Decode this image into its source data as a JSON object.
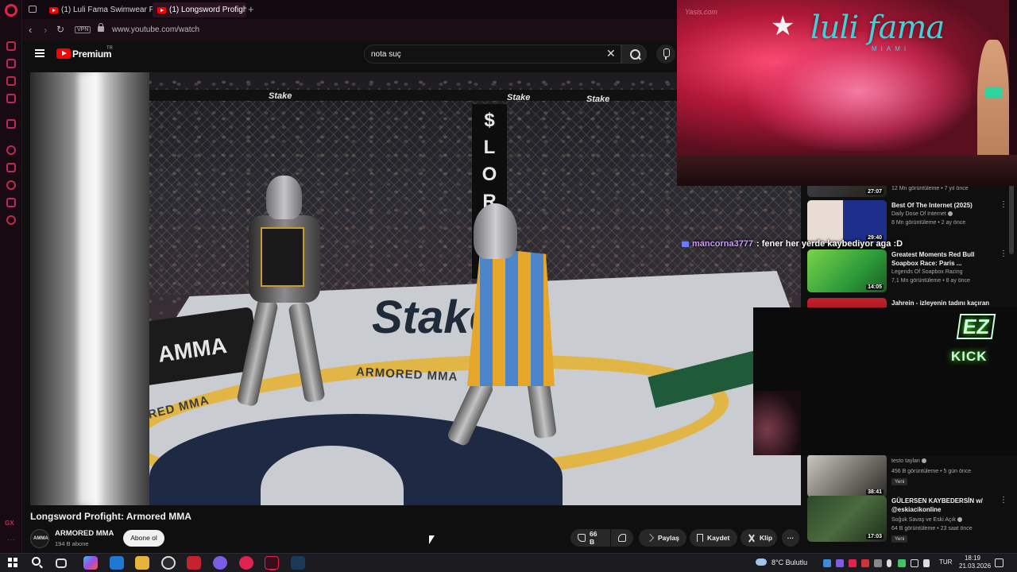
{
  "browser": {
    "tabs": [
      {
        "label": "(1) Luli Fama Swimwear Fa",
        "active": false
      },
      {
        "label": "(1) Longsword Profight",
        "active": true
      }
    ],
    "new_tab_symbol": "+",
    "url": "www.youtube.com/watch",
    "vpn_label": "VPN",
    "sidebar_badge": "GX",
    "sidebar_more": "···"
  },
  "youtube": {
    "brand": "Premium",
    "brand_sup": "TR",
    "search_value": "nota suç"
  },
  "video": {
    "title": "Longsword Profight: Armored MMA",
    "channel": "ARMORED MMA",
    "channel_avatar_text": "AMMA",
    "subscribers": "194 B abone",
    "subscribe_label": "Abone ol",
    "likes": "66 B",
    "share_label": "Paylaş",
    "save_label": "Kaydet",
    "clip_label": "Klip",
    "more_label": "···",
    "scene_text": {
      "pole": "$ L O R",
      "ring_text_1": "ARMORED MMA",
      "ring_text_2": "ORED MMA",
      "stake": "Stake",
      "banner": "AMMA",
      "sponsor": "Stake"
    }
  },
  "stream_overlay": {
    "watermark": "Yasis.com",
    "brand": "luli fama",
    "sub": "MIAMI"
  },
  "chat": {
    "user": "mancorna3777",
    "message": ": fener her yerde kaybediyor aga :D"
  },
  "kick_overlay": {
    "badge": "EZ",
    "logo": "KICK"
  },
  "recommendations": [
    {
      "title": "",
      "channel": "",
      "meta": "12 Mn görüntüleme • 7 yıl önce",
      "duration": "27:07",
      "new": ""
    },
    {
      "title": "Best Of The Internet (2025)",
      "channel": "Daily Dose Of Internet",
      "meta": "8 Mn görüntüleme • 2 ay önce",
      "duration": "29:40",
      "new": ""
    },
    {
      "title": "Greatest Moments Red Bull Soapbox Race: Paris ...",
      "channel": "Legends Of Soapbox Racing",
      "meta": "7,1 Mn görüntüleme • 8 ay önce",
      "duration": "14:05",
      "new": ""
    },
    {
      "title": "Jahrein - izleyenin tadını kaçıran",
      "channel": "",
      "meta": "",
      "duration": "",
      "new": ""
    },
    {
      "title": "",
      "channel": "testo taylan",
      "meta": "456 B görüntüleme • 5 gün önce",
      "duration": "38:41",
      "new": "Yeni"
    },
    {
      "title": "GÜLERSEN KAYBEDERSİN w/ @eskiacikonline",
      "channel": "Soğuk Savaş ve Eski Açık",
      "meta": "64 B görüntüleme • 23 saat önce",
      "duration": "17:03",
      "new": "Yeni"
    }
  ],
  "taskbar": {
    "weather": "8°C  Bulutlu",
    "lang": "TUR",
    "time": "18:19",
    "date": "21.03.2026"
  },
  "colors": {
    "accent": "#e0234e",
    "youtube_red": "#ff0000",
    "kick_green": "#53fc18",
    "brand_teal": "#3fd1d6"
  }
}
